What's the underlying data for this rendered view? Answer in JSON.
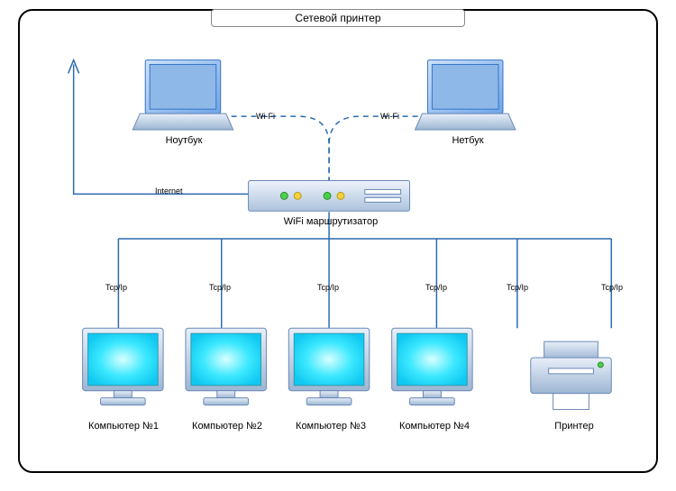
{
  "title": "Сетевой принтер",
  "devices": {
    "notebook": "Ноутбук",
    "netbook": "Нетбук",
    "router": "WiFi маршрутизатор",
    "pc1": "Компьютер №1",
    "pc2": "Компьютер №2",
    "pc3": "Компьютер №3",
    "pc4": "Компьютер №4",
    "printer": "Принтер"
  },
  "links": {
    "wifi": "Wi-Fi",
    "internet": "Internet",
    "tcpip": "Tcp/Ip"
  },
  "colors": {
    "laptop_fill": "#8eb8e8",
    "laptop_stroke": "#3573c6",
    "router_fill": "#c7d5e8",
    "router_stroke": "#6a88b8",
    "monitor_fill": "#2fe0ff",
    "monitor_case": "#bcd0e6",
    "printer_fill": "#d8e4f2",
    "wire": "#2a6ab0",
    "led_green": "#49d049",
    "led_yellow": "#f2d23a"
  }
}
